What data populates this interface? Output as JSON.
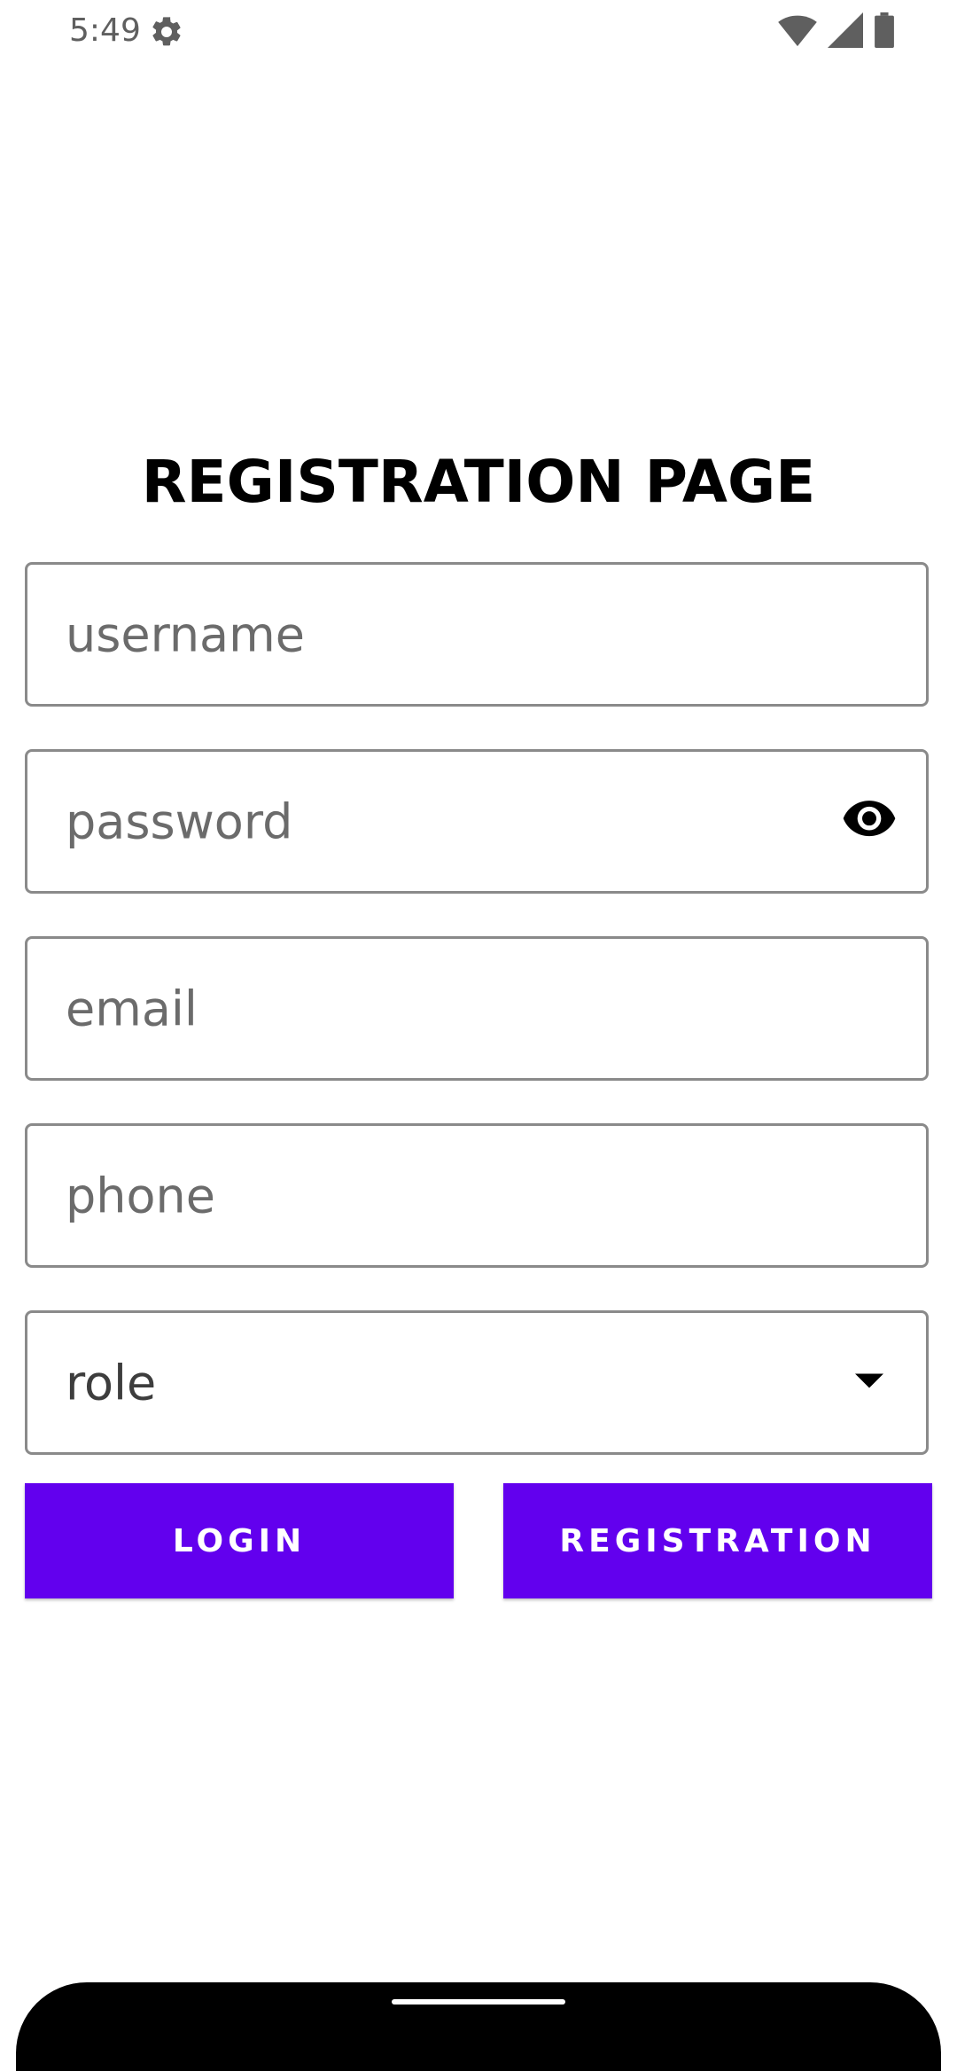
{
  "status_bar": {
    "time": "5:49",
    "icons": [
      "gear-icon",
      "wifi-icon",
      "signal-icon",
      "battery-icon"
    ]
  },
  "title": "REGISTRATION PAGE",
  "fields": {
    "username": {
      "placeholder": "username"
    },
    "password": {
      "placeholder": "password",
      "trailing_icon": "eye-icon"
    },
    "email": {
      "placeholder": "email"
    },
    "phone": {
      "placeholder": "phone"
    },
    "role": {
      "selected": "role",
      "trailing_icon": "dropdown-arrow-icon"
    }
  },
  "buttons": {
    "login": "LOGIN",
    "registration": "REGISTRATION"
  },
  "colors": {
    "accent": "#6200ee",
    "field_border": "#8a8a8a",
    "placeholder": "#6b6b6b"
  }
}
